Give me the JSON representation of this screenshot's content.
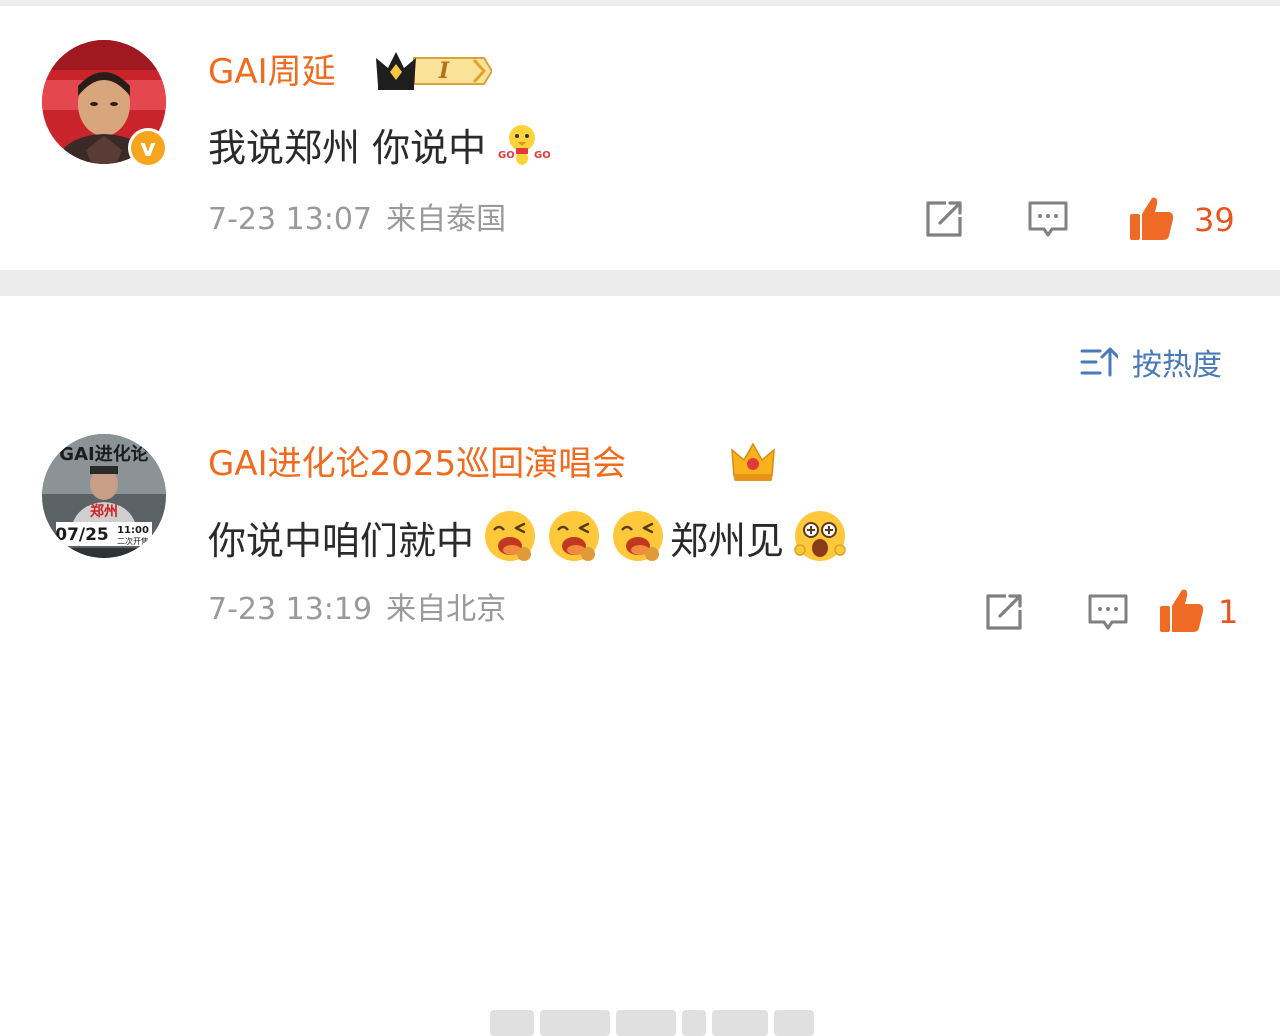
{
  "posts": [
    {
      "username": "GAI周延",
      "badge_level": "I",
      "text": "我说郑州 你说中",
      "emoji_label": "GO GO GO",
      "date": "7-23 13:07",
      "location": "来自泰国",
      "likes": "39",
      "icons": [
        "share-icon",
        "comment-icon",
        "like-icon"
      ]
    },
    {
      "username": "GAI进化论2025巡回演唱会",
      "avatar_text": {
        "top": "GAI进化论",
        "city": "郑州",
        "date": "07/25",
        "time": "11:00",
        "sale": "二次开售"
      },
      "text_a": "你说中咱们就中",
      "text_b": "郑州见",
      "date": "7-23 13:19",
      "location": "来自北京",
      "likes": "1",
      "icons": [
        "share-icon",
        "comment-icon",
        "like-icon"
      ]
    }
  ],
  "sort": {
    "label": "按热度",
    "icon": "sort-icon"
  },
  "colors": {
    "username": "#f26a1c",
    "like": "#e8541e",
    "link": "#4a79b8",
    "meta": "#9a9a9a",
    "divider": "#ececec"
  }
}
